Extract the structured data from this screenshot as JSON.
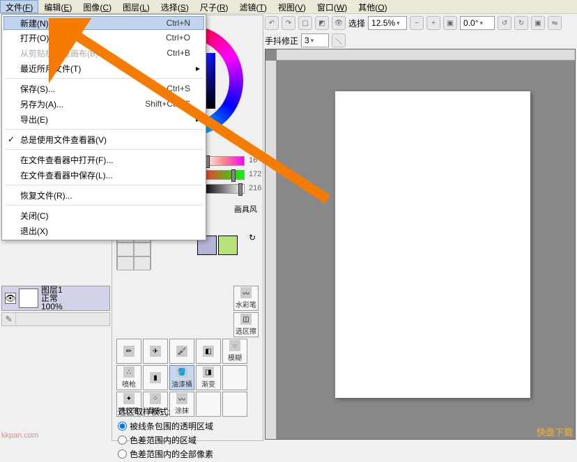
{
  "menubar": [
    {
      "label": "文件",
      "accel": "F",
      "active": true
    },
    {
      "label": "编辑",
      "accel": "E"
    },
    {
      "label": "图像",
      "accel": "C"
    },
    {
      "label": "图层",
      "accel": "L"
    },
    {
      "label": "选择",
      "accel": "S"
    },
    {
      "label": "尺子",
      "accel": "R"
    },
    {
      "label": "滤镜",
      "accel": "T"
    },
    {
      "label": "视图",
      "accel": "V"
    },
    {
      "label": "窗口",
      "accel": "W"
    },
    {
      "label": "其他",
      "accel": "O"
    }
  ],
  "file_menu": {
    "items": [
      {
        "label": "新建(N)...",
        "shortcut": "Ctrl+N",
        "highlight": true,
        "name": "new"
      },
      {
        "label": "打开(O)...",
        "shortcut": "Ctrl+O",
        "name": "open"
      },
      {
        "label": "从剪贴板创建画布(B)",
        "shortcut": "Ctrl+B",
        "disabled": true,
        "name": "from-clipboard"
      },
      {
        "label": "最近所用文件(T)",
        "submenu": true,
        "name": "recent"
      },
      {
        "sep": true
      },
      {
        "label": "保存(S)...",
        "shortcut": "Ctrl+S",
        "name": "save"
      },
      {
        "label": "另存为(A)...",
        "shortcut": "Shift+Ctrl+S",
        "name": "save-as"
      },
      {
        "label": "导出(E)",
        "submenu": true,
        "name": "export"
      },
      {
        "sep": true
      },
      {
        "label": "总是使用文件查看器(V)",
        "checked": true,
        "name": "always-use-viewer"
      },
      {
        "sep": true
      },
      {
        "label": "在文件查看器中打开(F)...",
        "name": "open-in-viewer"
      },
      {
        "label": "在文件查看器中保存(L)...",
        "name": "save-in-viewer"
      },
      {
        "sep": true
      },
      {
        "label": "恢复文件(R)...",
        "name": "revert"
      },
      {
        "sep": true
      },
      {
        "label": "关闭(C)",
        "name": "close"
      },
      {
        "label": "退出(X)",
        "name": "exit"
      }
    ]
  },
  "toolbar": {
    "select_label": "选择",
    "zoom": "12.5%",
    "angle": "0.0°",
    "stabilizer_label": "手抖修正",
    "stabilizer_value": "3"
  },
  "layer": {
    "name": "图层1",
    "mode": "正常",
    "opacity": "100%"
  },
  "sliders": {
    "v1": "16",
    "v2": "172",
    "v3": "216"
  },
  "panel_tab": "画具风",
  "swatch_colors": [
    "#b3b4d7",
    "#b8e27a"
  ],
  "brush_tools": {
    "row1": [
      {
        "name": "watercolor",
        "label": "水彩笔"
      }
    ],
    "row2": [
      {
        "name": "select",
        "label": "选区擦"
      }
    ],
    "row3": [
      {
        "name": "pencil",
        "label": ""
      },
      {
        "name": "airbrush",
        "label": ""
      },
      {
        "name": "brush",
        "label": ""
      },
      {
        "name": "eraser",
        "label": ""
      },
      {
        "name": "blur",
        "label": "模糊"
      }
    ],
    "row4": [
      {
        "name": "spray",
        "label": "喷枪"
      },
      {
        "name": "marker",
        "label": ""
      },
      {
        "name": "bucket",
        "label": "油漆桶",
        "selected": true
      },
      {
        "name": "gradient",
        "label": "渐变"
      },
      {
        "name": "empty1",
        "label": ""
      }
    ],
    "row5": [
      {
        "name": "effect",
        "label": "特效笔"
      },
      {
        "name": "scatter",
        "label": "散布"
      },
      {
        "name": "smear",
        "label": "涂抹"
      },
      {
        "name": "empty2",
        "label": ""
      },
      {
        "name": "empty3",
        "label": ""
      }
    ]
  },
  "selection_mode": {
    "title": "选区取样模式:",
    "options": [
      {
        "label": "被线条包围的透明区域",
        "checked": true
      },
      {
        "label": "色差范围内的区域"
      },
      {
        "label": "色差范围内的全部像素"
      }
    ]
  },
  "watermarks": {
    "left": "kkpan.com",
    "right": "快盘下载"
  }
}
